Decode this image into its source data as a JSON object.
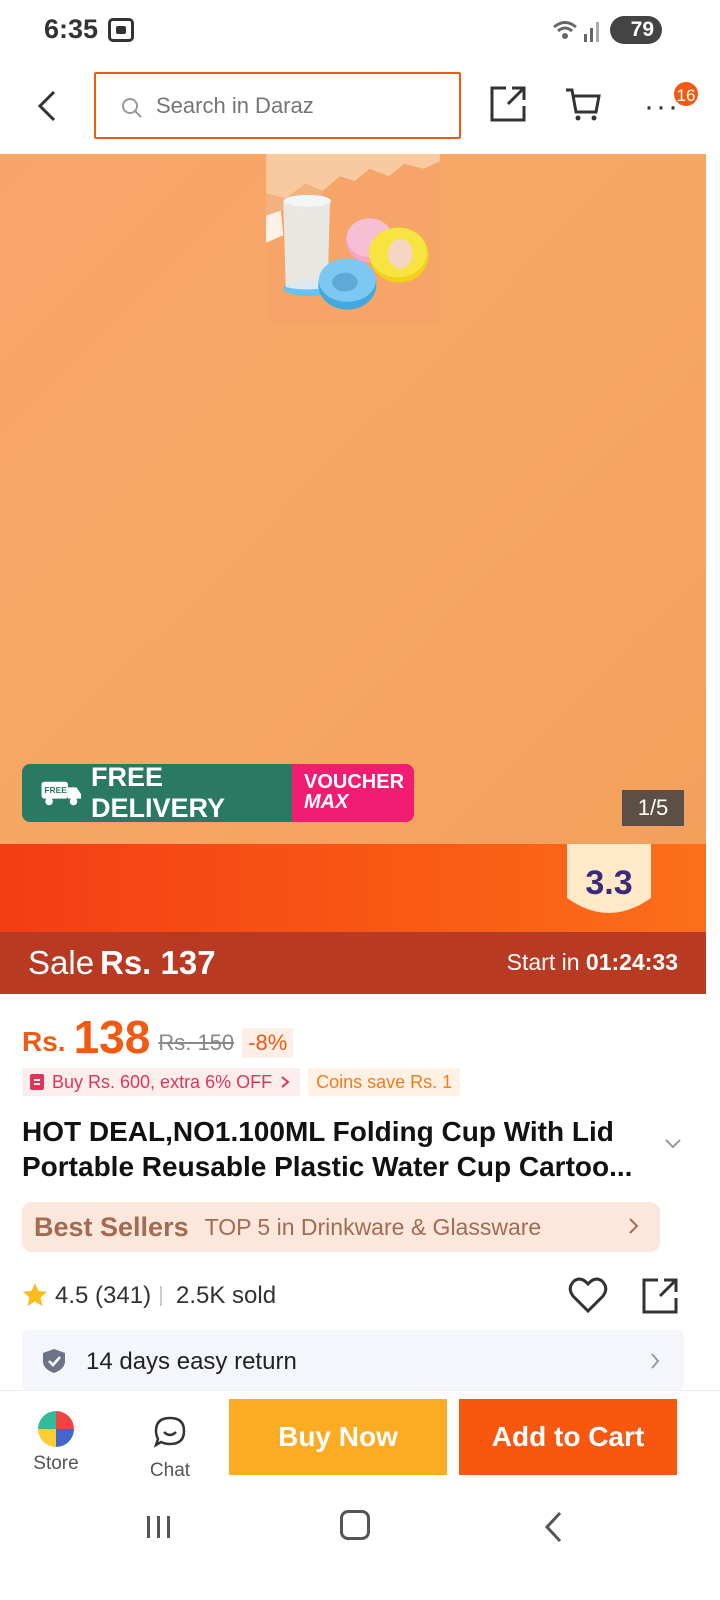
{
  "status_bar": {
    "time": "6:35",
    "battery": "79"
  },
  "top_nav": {
    "search_placeholder": "Search in Daraz",
    "cart_badge": "16"
  },
  "gallery": {
    "free_delivery_tag": "FREE",
    "free_delivery": "FREE DELIVERY",
    "voucher_line1": "VOUCHER",
    "voucher_line2": "MAX",
    "counter": "1/5"
  },
  "campaign": {
    "badge": "3.3"
  },
  "sale": {
    "label": "Sale",
    "price": "Rs. 137",
    "start_label": "Start in",
    "countdown": "01:24:33"
  },
  "price": {
    "currency": "Rs.",
    "current": "138",
    "original": "Rs. 150",
    "discount": "-8%"
  },
  "promos": {
    "bundle": "Buy Rs. 600, extra 6% OFF",
    "coins": "Coins save Rs. 1"
  },
  "product": {
    "title": "HOT DEAL,NO1.100ML Folding Cup With Lid Portable Reusable Plastic Water Cup Cartoo..."
  },
  "best_sellers": {
    "logo": "Best Sellers",
    "text": "TOP 5 in Drinkware & Glassware"
  },
  "rating": {
    "score": "4.5",
    "count": "(341)",
    "sold": "2.5K sold"
  },
  "returns": {
    "text": "14 days easy return"
  },
  "bottom_bar": {
    "store": "Store",
    "chat": "Chat",
    "buy_now": "Buy Now",
    "add_to_cart": "Add to Cart"
  },
  "colors": {
    "brand": "#f05a12",
    "buy_now": "#fcac22",
    "add_to_cart": "#f7570e",
    "sale_bar": "#b93a22",
    "free_delivery": "#2a7a63",
    "voucher": "#f21c72"
  }
}
